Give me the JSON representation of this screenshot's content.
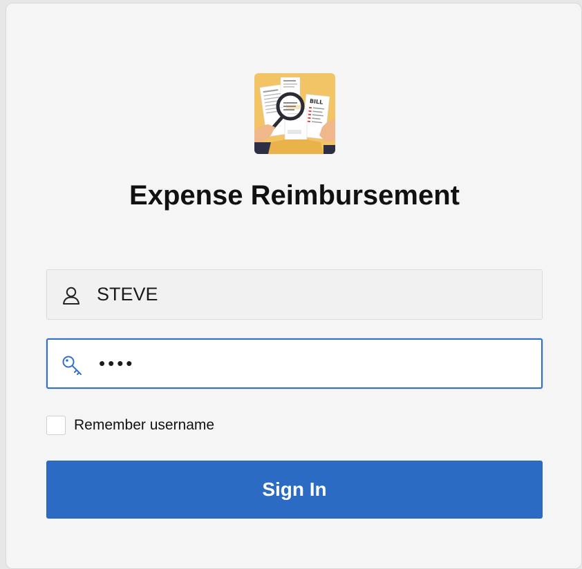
{
  "app": {
    "title": "Expense Reimbursement",
    "logo": {
      "icon": "expense-audit-logo",
      "bill_label": "BILL",
      "colors": {
        "background": "#f2c466",
        "paper": "#ffffff",
        "hand": "#f0b88a",
        "sleeve": "#2d2f45",
        "lens_ring": "#2b2b35"
      }
    }
  },
  "login": {
    "username": {
      "icon": "user-icon",
      "value": "STEVE"
    },
    "password": {
      "icon": "key-icon",
      "value": "••••"
    },
    "remember": {
      "label": "Remember username",
      "checked": false
    },
    "submit_label": "Sign In"
  },
  "colors": {
    "accent": "#2c6bc3",
    "focus_border": "#2f6fd0",
    "card_background": "#f5f5f5"
  }
}
